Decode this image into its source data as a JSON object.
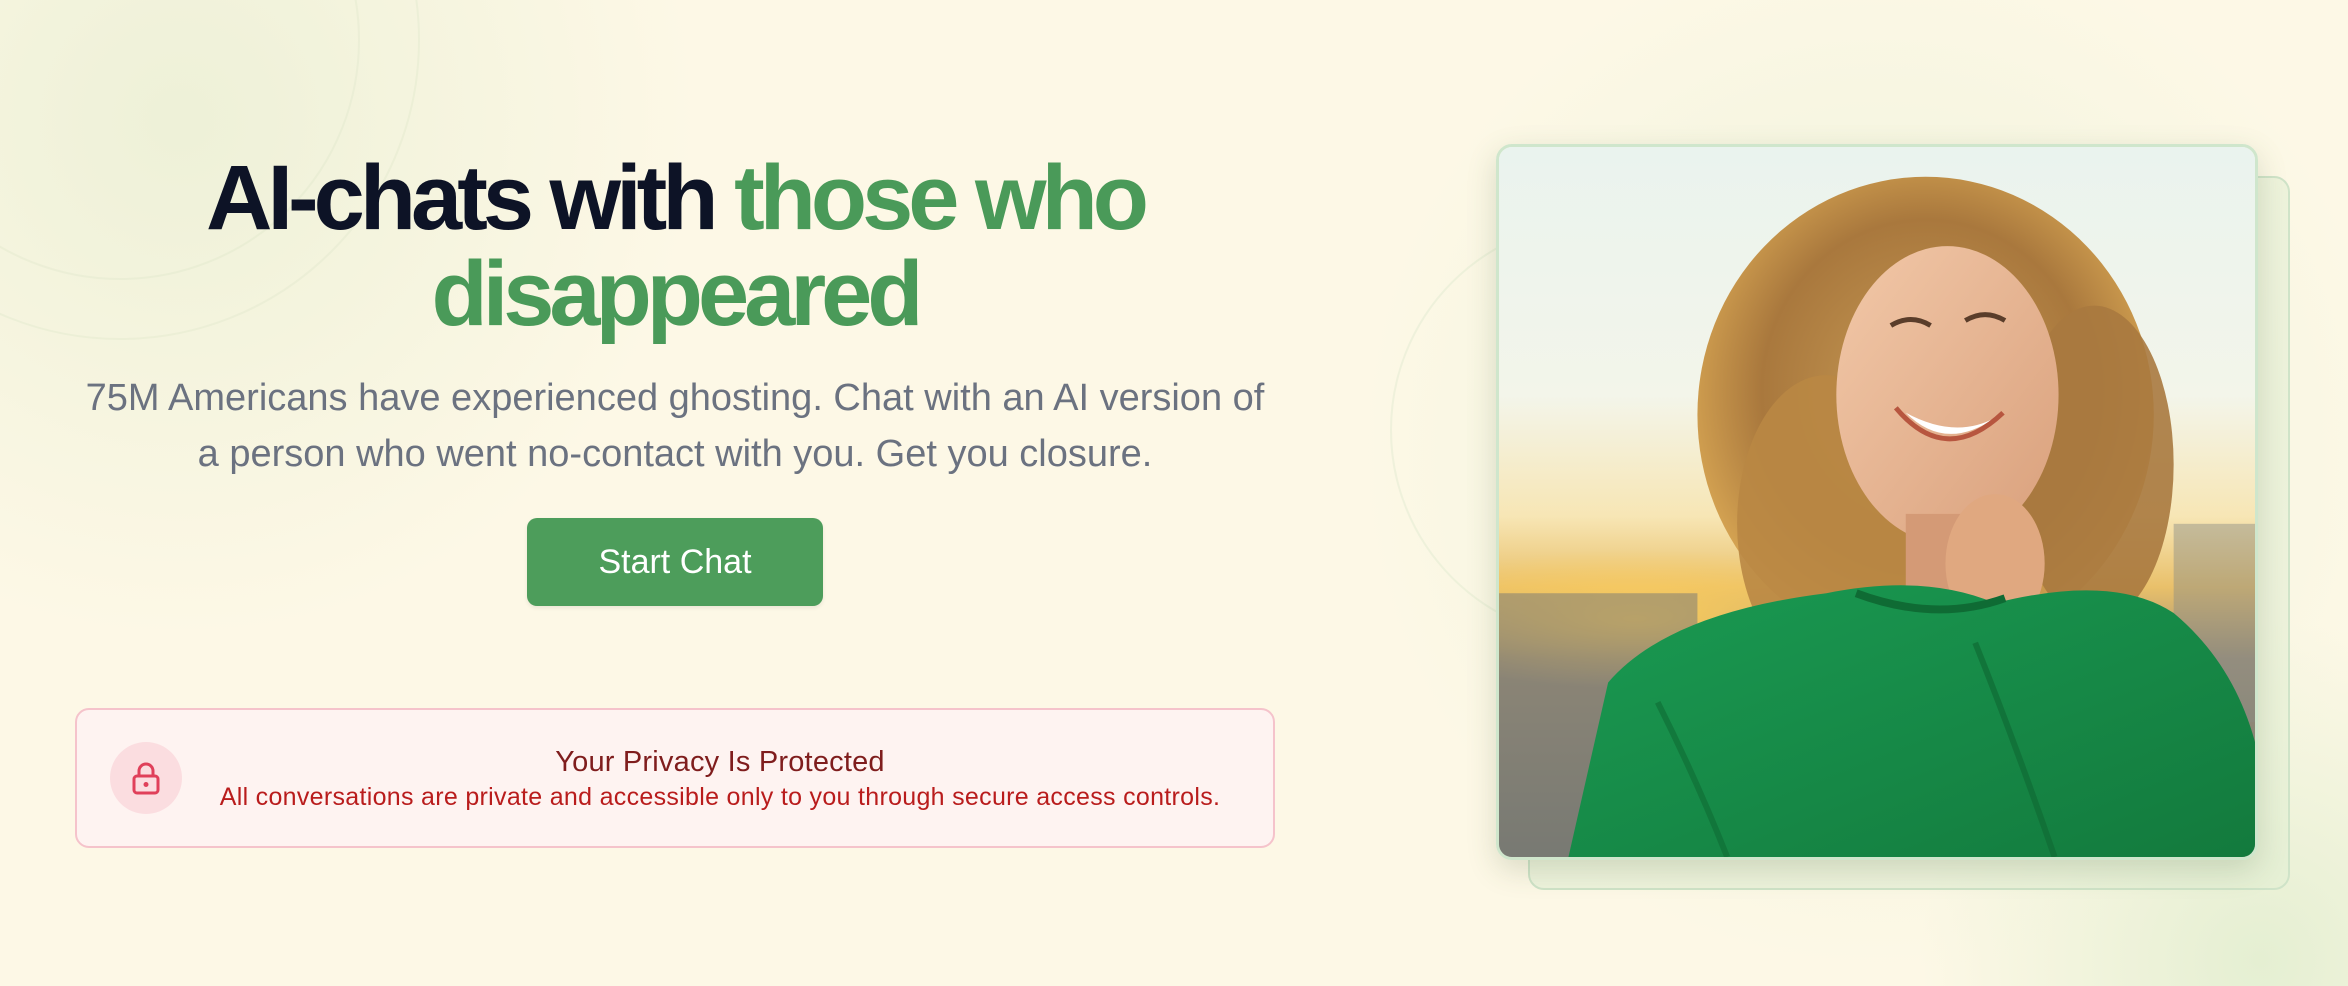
{
  "hero": {
    "headline_part1": "AI-chats with ",
    "headline_accent_line1": "those who",
    "headline_accent_line2": "disappeared",
    "subtitle": "75M Americans have experienced ghosting. Chat with an AI version of a person who went no-contact with you. Get you closure.",
    "cta_label": "Start Chat"
  },
  "privacy": {
    "icon": "lock-icon",
    "title": "Your Privacy Is Protected",
    "body": "All conversations are private and accessible only to you through secure access controls."
  },
  "photo": {
    "subject": "smiling-woman-photo"
  },
  "colors": {
    "background": "#fdf8e6",
    "headline_dark": "#0d1326",
    "accent_green": "#4a9a59",
    "button_green": "#4d9d5b",
    "subtitle_gray": "#6b7280",
    "privacy_bg": "#fef3f1",
    "privacy_border": "#f5c3cb",
    "privacy_title": "#7f1d1d",
    "privacy_text": "#b91c1c"
  }
}
